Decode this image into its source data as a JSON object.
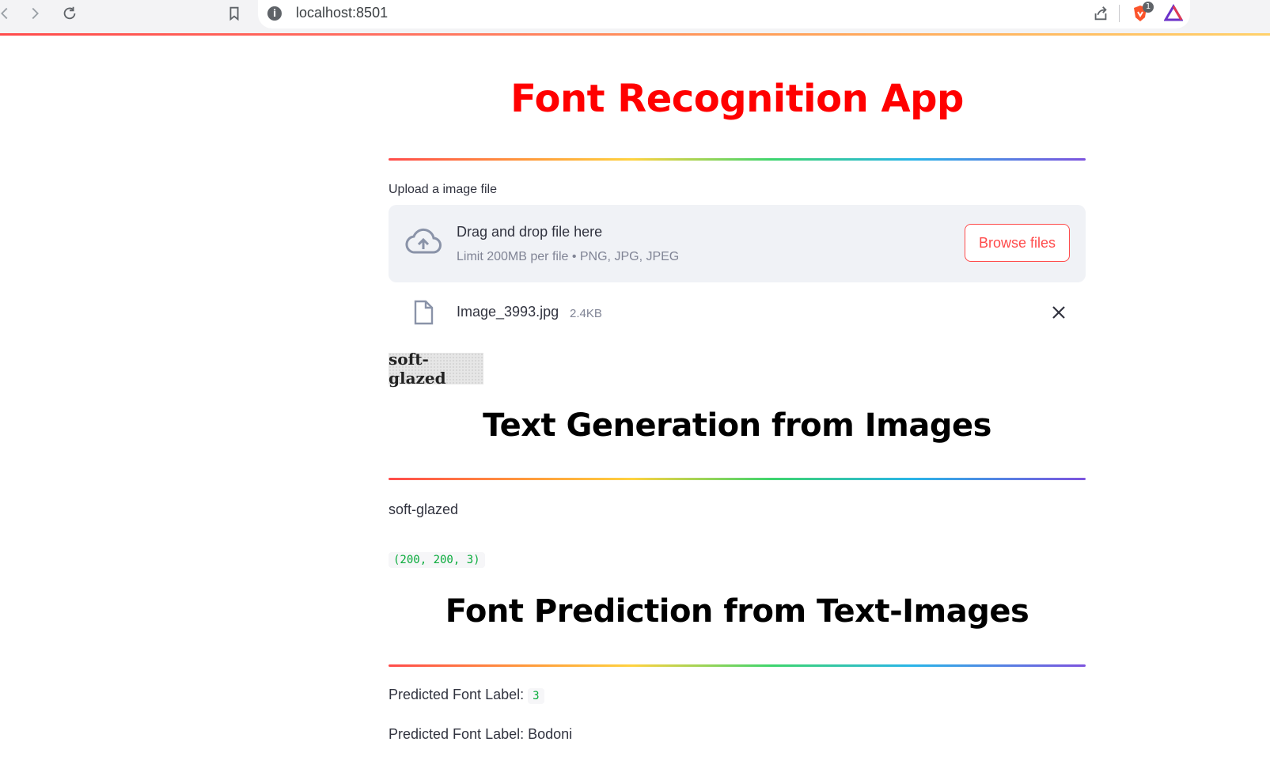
{
  "browser": {
    "url": "localhost:8501",
    "info_glyph": "i",
    "ext_badge": "1",
    "icons": [
      "back-icon",
      "forward-icon",
      "reload-icon",
      "bookmark-icon",
      "share-icon",
      "brave-shield-icon",
      "brave-rewards-icon"
    ]
  },
  "app": {
    "title": "Font Recognition App",
    "accent_color": "#ff0000"
  },
  "uploader": {
    "label": "Upload a image file",
    "drop_title": "Drag and drop file here",
    "drop_subtitle": "Limit 200MB per file • PNG, JPG, JPEG",
    "browse_label": "Browse files",
    "file_name": "Image_3993.jpg",
    "file_size": "2.4KB"
  },
  "preview": {
    "image_text": "soft-glazed"
  },
  "section_text_gen": {
    "heading": "Text Generation from Images",
    "generated_text": "soft-glazed",
    "shape": "(200, 200, 3)"
  },
  "section_font_pred": {
    "heading": "Font Prediction from Text-Images",
    "label_prefix": "Predicted Font Label:",
    "label_value": "3",
    "name_line": "Predicted Font Label: Bodoni"
  }
}
